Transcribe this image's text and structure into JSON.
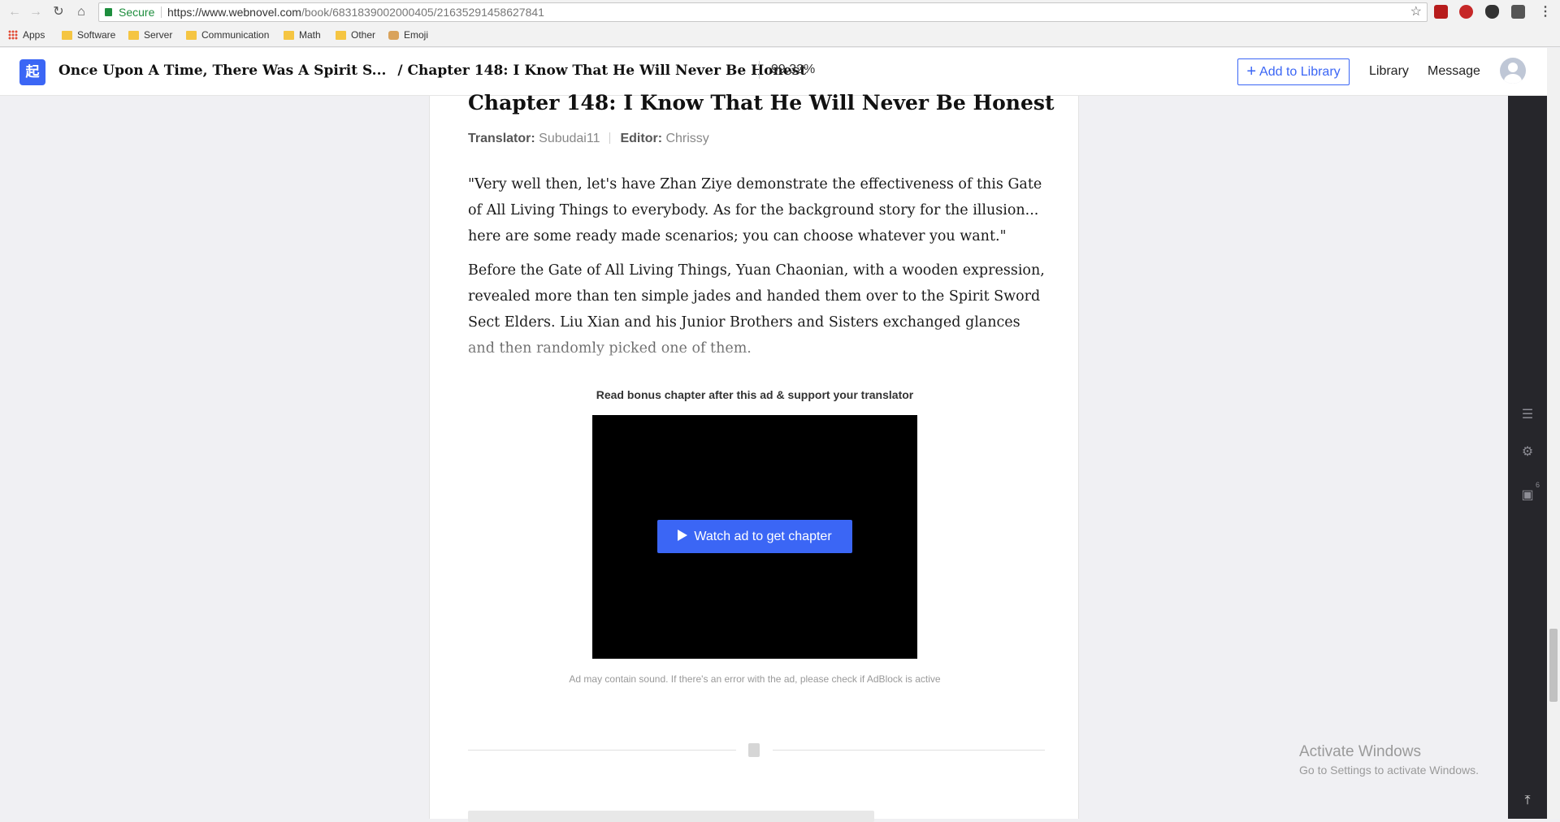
{
  "browser": {
    "secure_label": "Secure",
    "url_host": "https://www.webnovel.com",
    "url_path": "/book/6831839002000405/21635291458627841"
  },
  "bookmarks": {
    "apps": "Apps",
    "items": [
      "Software",
      "Server",
      "Communication",
      "Math",
      "Other",
      "Emoji"
    ]
  },
  "header": {
    "logo_glyph": "起",
    "book_title": "Once Upon A Time, There Was A Spirit S...",
    "chapter_title": "/ Chapter 148: I Know That He Will Never Be Honest",
    "progress": "99.32%",
    "add_library": "Add to Library",
    "library": "Library",
    "message": "Message"
  },
  "chapter": {
    "title": "Chapter 148: I Know That He Will Never Be Honest",
    "translator_label": "Translator:",
    "translator": "Subudai11",
    "editor_label": "Editor:",
    "editor": "Chrissy",
    "paragraphs": [
      "\"Very well then, let's have Zhan Ziye demonstrate the effectiveness of this Gate of All Living Things to everybody. As for the background story for the illusion... here are some ready made scenarios; you can choose whatever you want.\"",
      "Before the Gate of All Living Things, Yuan Chaonian, with a wooden expression, revealed more than ten simple jades and handed them over to the Spirit Sword Sect Elders. Liu Xian and his Junior Brothers and Sisters exchanged glances and then randomly picked one of them."
    ]
  },
  "ad": {
    "label": "Read bonus chapter after this ad & support your translator",
    "button": "Watch ad to get chapter",
    "note": "Ad may contain sound. If there's an error with the ad, please check if AdBlock is active"
  },
  "rail": {
    "badge": "6"
  },
  "windows": {
    "line1": "Activate Windows",
    "line2": "Go to Settings to activate Windows."
  },
  "colors": {
    "accent": "#3b66f5",
    "rail": "#26262b"
  }
}
